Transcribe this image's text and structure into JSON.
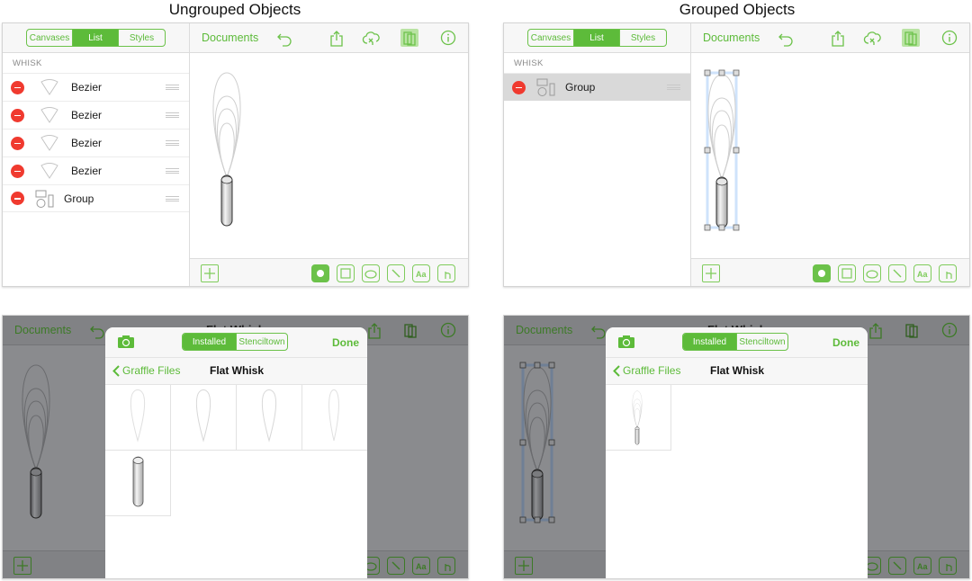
{
  "captions": {
    "left": "Ungrouped Objects",
    "right": "Grouped Objects"
  },
  "colors": {
    "accent": "#5dbb3a",
    "delete": "#f03a2f",
    "selection": "#cfe3fb",
    "dim_overlay": "#8a8b8e"
  },
  "sidebar": {
    "tabs": [
      "Canvases",
      "List",
      "Styles"
    ],
    "active_tab": "List",
    "section_label": "WHISK"
  },
  "ungrouped_list": [
    {
      "label": "Bezier",
      "icon": "bezier-shape-icon"
    },
    {
      "label": "Bezier",
      "icon": "bezier-shape-icon"
    },
    {
      "label": "Bezier",
      "icon": "bezier-shape-icon"
    },
    {
      "label": "Bezier",
      "icon": "bezier-shape-icon"
    },
    {
      "label": "Group",
      "icon": "group-icon"
    }
  ],
  "grouped_list": [
    {
      "label": "Group",
      "icon": "group-icon",
      "selected": true
    }
  ],
  "toolbar": {
    "documents_label": "Documents",
    "icons": [
      "undo-icon",
      "share-icon",
      "cloud-sync-icon",
      "stencils-icon",
      "info-icon"
    ],
    "document_title": "Flat Whisk"
  },
  "bottom_tools": [
    "add-icon",
    "selection-tool-icon",
    "shape-tool-icon",
    "freehand-tool-icon",
    "line-tool-icon",
    "text-tool-icon",
    "touch-tool-icon"
  ],
  "stencil_popover": {
    "segments": [
      "Installed",
      "Stenciltown"
    ],
    "active_segment": "Installed",
    "done_label": "Done",
    "back_label": "Graffle Files",
    "title": "Flat Whisk",
    "ungrouped_items": [
      "teardrop",
      "teardrop",
      "teardrop",
      "teardrop",
      "cylinder"
    ],
    "grouped_items": [
      "whisk"
    ]
  }
}
